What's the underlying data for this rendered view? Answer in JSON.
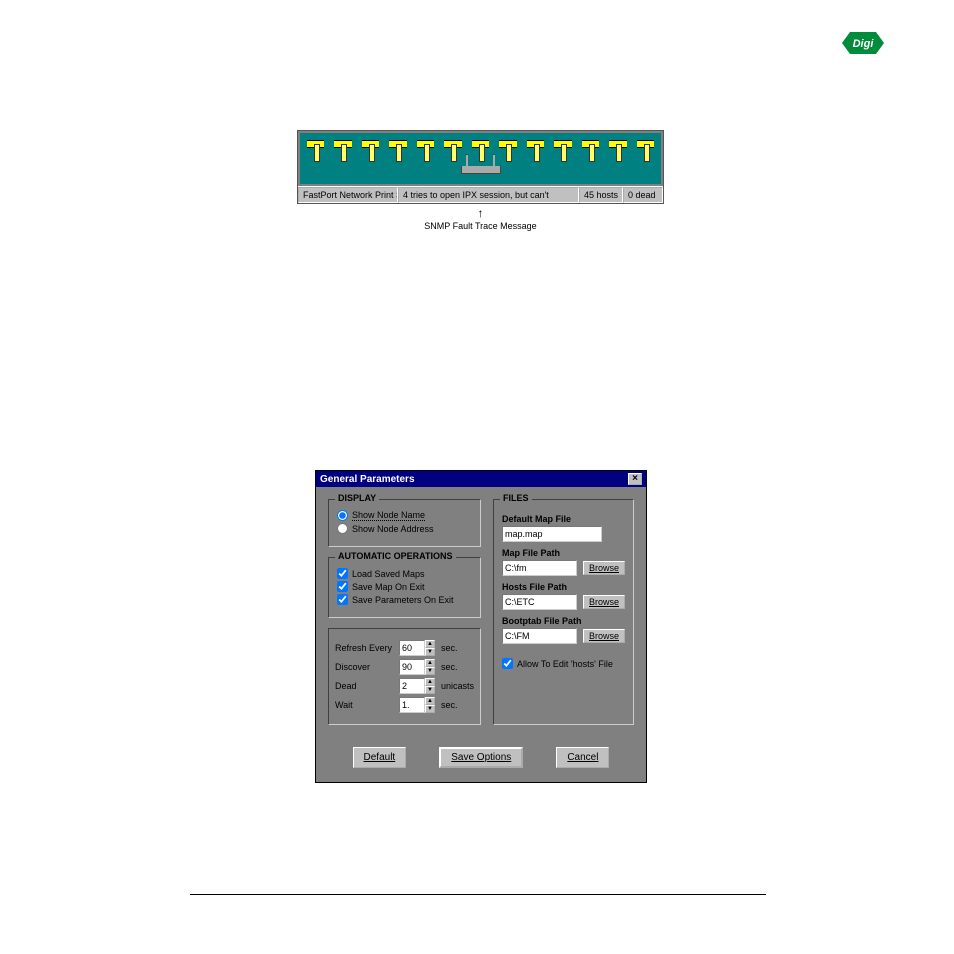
{
  "logo_text": "Digi",
  "status": {
    "device": "FastPort Network Print Serv.",
    "message": "4 tries to open IPX session, but can't",
    "hosts": "45 hosts",
    "dead": "0 dead"
  },
  "fault_caption": "SNMP Fault Trace Message",
  "dialog": {
    "title": "General Parameters",
    "display": {
      "legend": "DISPLAY",
      "show_node_name": "Show Node Name",
      "show_node_address": "Show Node Address"
    },
    "auto": {
      "legend": "AUTOMATIC OPERATIONS",
      "load_saved_maps": "Load Saved Maps",
      "save_map_on_exit": "Save Map On Exit",
      "save_params_on_exit": "Save Parameters On Exit"
    },
    "timing": {
      "refresh_label": "Refresh Every",
      "refresh_value": "60",
      "discover_label": "Discover",
      "discover_value": "90",
      "dead_label": "Dead",
      "dead_value": "2",
      "wait_label": "Wait",
      "wait_value": "1.",
      "sec": "sec.",
      "unicasts": "unicasts"
    },
    "files": {
      "legend": "FILES",
      "default_map_label": "Default Map File",
      "default_map_value": "map.map",
      "map_path_label": "Map File Path",
      "map_path_value": "C:\\fm",
      "hosts_path_label": "Hosts File Path",
      "hosts_path_value": "C:\\ETC",
      "boot_path_label": "Bootptab File Path",
      "boot_path_value": "C:\\FM",
      "browse": "Browse",
      "allow_edit": "Allow To Edit 'hosts' File"
    },
    "buttons": {
      "default": "Default",
      "save": "Save Options",
      "cancel": "Cancel"
    }
  }
}
